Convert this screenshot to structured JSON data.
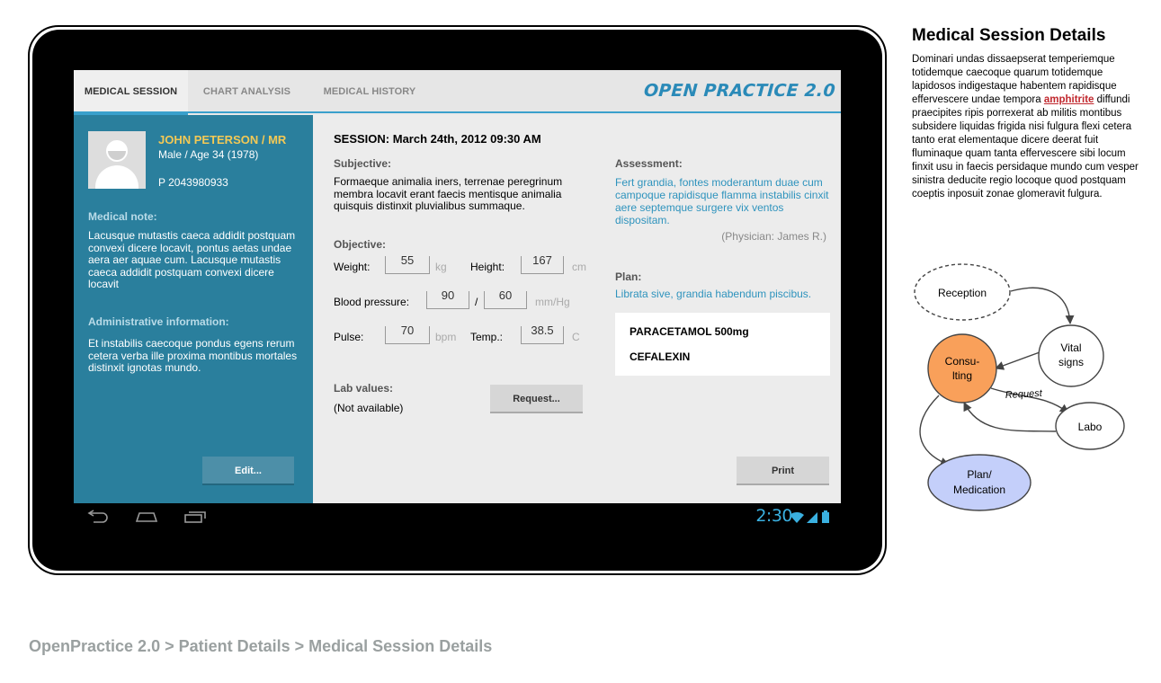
{
  "tabs": [
    {
      "label": "MEDICAL SESSION",
      "active": true
    },
    {
      "label": "CHART ANALYSIS",
      "active": false
    },
    {
      "label": "MEDICAL HISTORY",
      "active": false
    }
  ],
  "brand": "OPEN PRACTICE 2.0",
  "patient": {
    "name": "JOHN PETERSON / MR",
    "info": "Male / Age 34 (1978)",
    "phone": "P 2043980933",
    "medical_note_title": "Medical note:",
    "medical_note": "Lacusque mutastis caeca addidit postquam convexi dicere locavit, pontus aetas undae aera aer aquae cum. Lacusque mutastis caeca addidit postquam convexi dicere locavit",
    "admin_title": "Administrative information:",
    "admin_text": "Et  instabilis caecoque pondus egens rerum cetera verba ille proxima montibus mortales distinxit ignotas mundo.",
    "edit_label": "Edit..."
  },
  "session": {
    "title": "SESSION: March 24th, 2012 09:30 AM",
    "subjective_title": "Subjective:",
    "subjective_text": "Formaeque animalia iners, terrenae peregrinum membra locavit erant faecis mentisque animalia quisquis distinxit pluvialibus summaque.",
    "objective_title": "Objective:",
    "weight_label": "Weight:",
    "weight_value": "55",
    "weight_unit": "kg",
    "height_label": "Height:",
    "height_value": "167",
    "height_unit": "cm",
    "bp_label": "Blood pressure:",
    "bp_systolic": "90",
    "bp_separator": "/",
    "bp_diastolic": "60",
    "bp_unit": "mm/Hg",
    "pulse_label": "Pulse:",
    "pulse_value": "70",
    "pulse_unit": "bpm",
    "temp_label": "Temp.:",
    "temp_value": "38.5",
    "temp_unit": "C",
    "lab_title": "Lab values:",
    "lab_text": "(Not available)",
    "request_label": "Request...",
    "assessment_title": "Assessment:",
    "assessment_text": "Fert grandia, fontes moderantum duae cum campoque rapidisque flamma instabilis cinxit aere septemque surgere vix ventos dispositam.",
    "physician": "(Physician: James R.)",
    "plan_title": "Plan:",
    "plan_text": "Librata sive, grandia habendum piscibus.",
    "medications": [
      "PARACETAMOL 500mg",
      "CEFALEXIN"
    ],
    "print_label": "Print"
  },
  "statusbar": {
    "clock": "2:30"
  },
  "description": {
    "title": "Medical Session Details",
    "text_before": "Dominari undas dissaepserat temperiemque totidemque caecoque quarum totidemque lapidosos indigestaque habentem rapidisque effervescere undae tempora ",
    "link": "amphitrite",
    "text_after": " diffundi praecipites ripis porrexerat ab militis montibus subsidere liquidas frigida nisi fulgura flexi cetera tanto erat elementaque dicere deerat fuit fluminaque quam tanta effervescere sibi locum finxit usu in faecis persidaque mundo cum vesper sinistra deducite regio locoque quod postquam coeptis inposuit zonae glomeravit fulgura."
  },
  "diagram": {
    "reception": "Reception",
    "vital1": "Vital",
    "vital2": "signs",
    "consult1": "Consu-",
    "consult2": "lting",
    "request": "Request",
    "labo": "Labo",
    "plan1": "Plan/",
    "plan2": "Medication",
    "colors": {
      "consulting": "#f9a05a",
      "plan": "#c4cffa"
    }
  },
  "breadcrumb": "OpenPractice 2.0 > Patient Details > Medical Session Details"
}
